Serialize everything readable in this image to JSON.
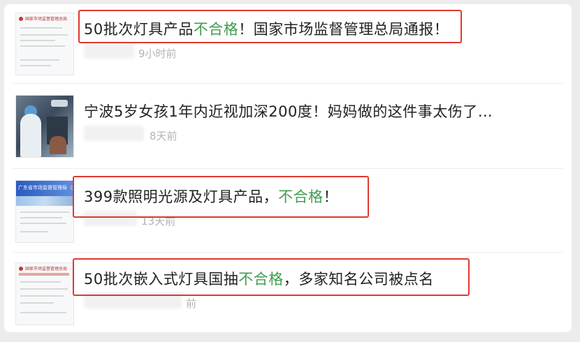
{
  "feed": {
    "items": [
      {
        "title_parts": [
          "50批次灯具产品",
          "不合格",
          "！国家市场监督管理总局通报！"
        ],
        "time": "9小时前",
        "thumb_text": "国家市场监督管理总局"
      },
      {
        "title_parts": [
          "宁波5岁女孩1年内近视加深200度！妈妈做的这件事太伤了…",
          "",
          ""
        ],
        "time": "8天前",
        "thumb_text": ""
      },
      {
        "title_parts": [
          "399款照明光源及灯具产品，",
          "不合格",
          "！"
        ],
        "time": "13天前",
        "thumb_text": "广东省市场监督管理局（知识"
      },
      {
        "title_parts": [
          "50批次嵌入式灯具国抽",
          "不合格",
          "，多家知名公司被点名"
        ],
        "time": "前",
        "thumb_text": "国家市场监督管理总局"
      }
    ]
  },
  "colors": {
    "highlight": "#3f9c4f",
    "frame": "#e0392e",
    "title": "#222222",
    "meta": "#b3b3b3"
  }
}
